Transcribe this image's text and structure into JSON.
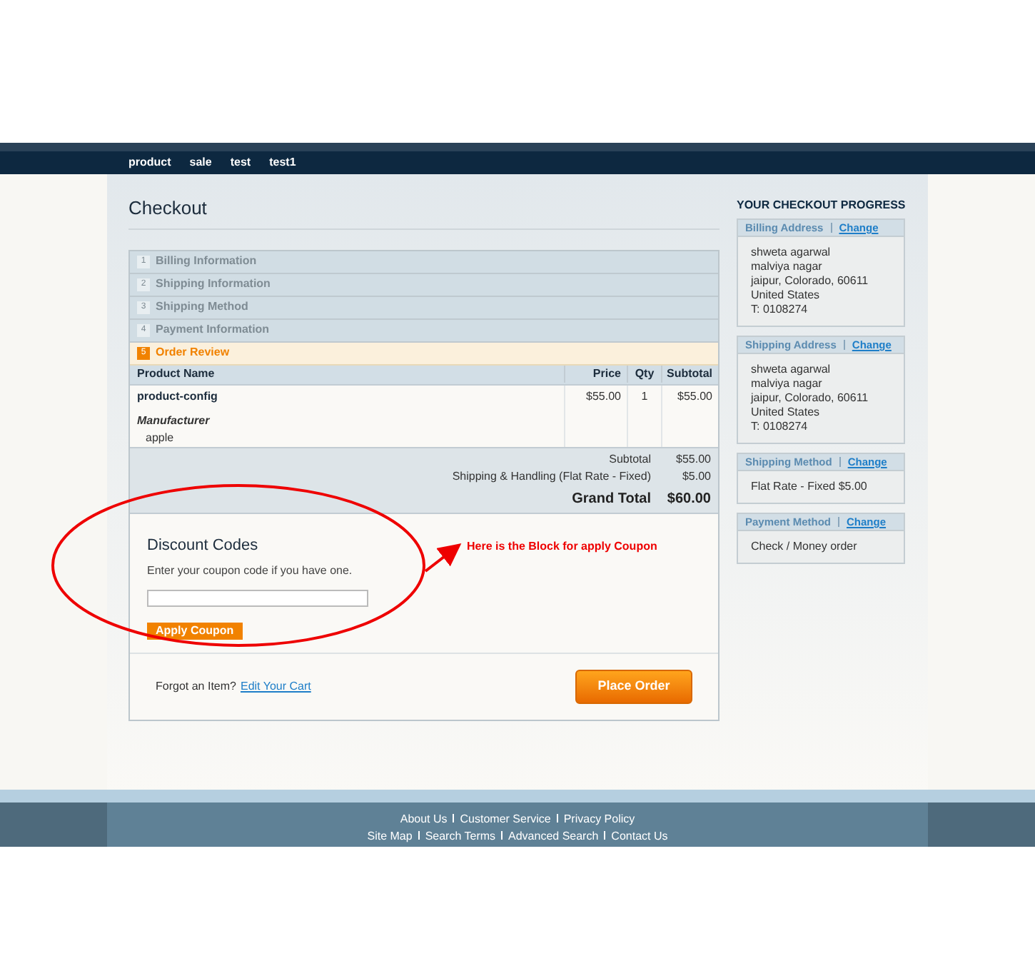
{
  "nav": [
    "product",
    "sale",
    "test",
    "test1"
  ],
  "page_title": "Checkout",
  "steps": [
    {
      "number": "1",
      "label": "Billing Information",
      "selected": false
    },
    {
      "number": "2",
      "label": "Shipping Information",
      "selected": false
    },
    {
      "number": "3",
      "label": "Shipping Method",
      "selected": false
    },
    {
      "number": "4",
      "label": "Payment Information",
      "selected": false
    },
    {
      "number": "5",
      "label": "Order Review",
      "selected": true
    }
  ],
  "table": {
    "columns": [
      "Product Name",
      "Price",
      "Qty",
      "Subtotal"
    ],
    "rows": [
      {
        "name": "product-config",
        "option_label": "Manufacturer",
        "option_value": "apple",
        "price": "$55.00",
        "qty": "1",
        "subtotal": "$55.00"
      }
    ],
    "totals": [
      {
        "label": "Subtotal",
        "value": "$55.00",
        "kind": "normal"
      },
      {
        "label": "Shipping & Handling (Flat Rate - Fixed)",
        "value": "$5.00",
        "kind": "normal"
      },
      {
        "label": "Grand Total",
        "value": "$60.00",
        "kind": "grand"
      }
    ]
  },
  "discount": {
    "title": "Discount Codes",
    "hint": "Enter your coupon code if you have one.",
    "button": "Apply Coupon"
  },
  "annotation": "Here is the Block for apply Coupon",
  "forgot": {
    "text": "Forgot an Item?",
    "link": "Edit Your Cart"
  },
  "place_order": "Place Order",
  "progress": {
    "title": "YOUR CHECKOUT PROGRESS",
    "sections": [
      {
        "title": "Billing Address",
        "change": "Change",
        "lines": [
          "shweta agarwal",
          "malviya nagar",
          "jaipur, Colorado, 60611",
          "United States",
          "T: 0108274"
        ]
      },
      {
        "title": "Shipping Address",
        "change": "Change",
        "lines": [
          "shweta agarwal",
          "malviya nagar",
          "jaipur, Colorado, 60611",
          "United States",
          "T: 0108274"
        ]
      },
      {
        "title": "Shipping Method",
        "change": "Change",
        "lines": [
          "Flat Rate - Fixed $5.00"
        ]
      },
      {
        "title": "Payment Method",
        "change": "Change",
        "lines": [
          "Check / Money order"
        ]
      }
    ]
  },
  "footer": [
    [
      "About Us",
      "Customer Service",
      "Privacy Policy"
    ],
    [
      "Site Map",
      "Search Terms",
      "Advanced Search",
      "Contact Us"
    ]
  ]
}
